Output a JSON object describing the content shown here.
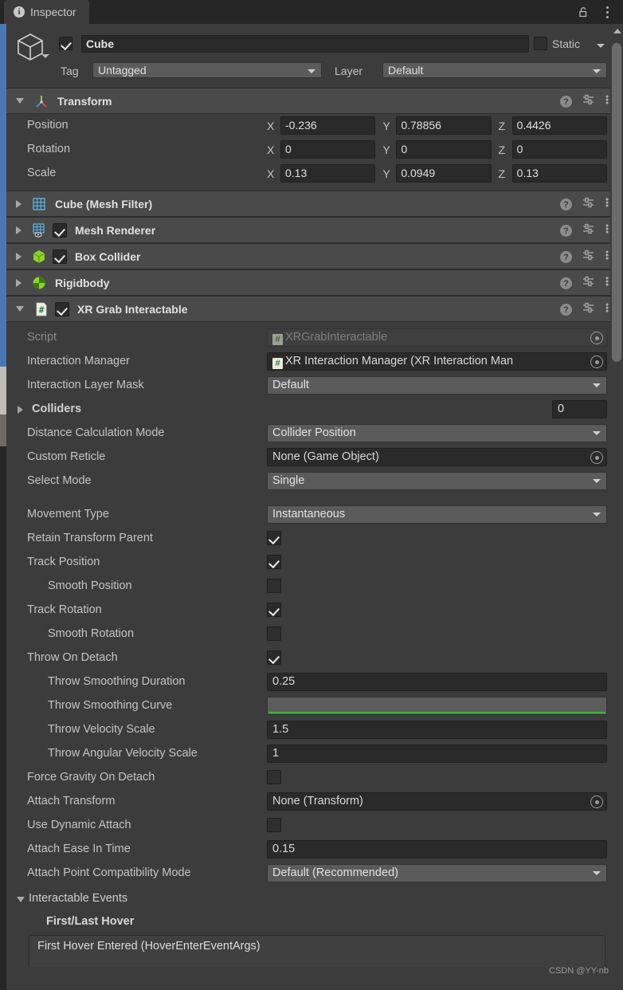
{
  "window": {
    "tab_label": "Inspector",
    "info_icon": "info-icon",
    "lock_icon": "lock-icon",
    "menu_icon": "kebab-menu-icon"
  },
  "object_header": {
    "icon": "cube-icon",
    "enabled": true,
    "name": "Cube",
    "static_label": "Static",
    "static_checked": false,
    "tag_label": "Tag",
    "tag_value": "Untagged",
    "layer_label": "Layer",
    "layer_value": "Default"
  },
  "transform": {
    "title": "Transform",
    "icon": "transform-axis-icon",
    "expanded": true,
    "rows": [
      {
        "label": "Position",
        "x": "-0.236",
        "y": "0.78856",
        "z": "0.4426"
      },
      {
        "label": "Rotation",
        "x": "0",
        "y": "0",
        "z": "0"
      },
      {
        "label": "Scale",
        "x": "0.13",
        "y": "0.0949",
        "z": "0.13"
      }
    ],
    "axes": [
      "X",
      "Y",
      "Z"
    ]
  },
  "components": [
    {
      "title": "Cube (Mesh Filter)",
      "icon": "mesh-filter-icon",
      "expanded": false,
      "has_checkbox": false,
      "checked": false
    },
    {
      "title": "Mesh Renderer",
      "icon": "mesh-renderer-icon",
      "expanded": false,
      "has_checkbox": true,
      "checked": true
    },
    {
      "title": "Box Collider",
      "icon": "box-collider-icon",
      "expanded": false,
      "has_checkbox": true,
      "checked": true
    },
    {
      "title": "Rigidbody",
      "icon": "rigidbody-icon",
      "expanded": false,
      "has_checkbox": false,
      "checked": false
    },
    {
      "title": "XR Grab Interactable",
      "icon": "script-icon",
      "expanded": true,
      "has_checkbox": true,
      "checked": true
    }
  ],
  "header_icons": {
    "help": "?",
    "help_name": "help-icon",
    "preset_name": "preset-settings-icon",
    "menu_name": "kebab-menu-icon"
  },
  "xr_grab_interactable": {
    "properties": [
      {
        "label": "Script",
        "type": "object-disabled",
        "value": "XRGrabInteractable",
        "icon": "script-icon"
      },
      {
        "label": "Interaction Manager",
        "type": "object",
        "value": "XR Interaction Manager (XR Interaction Man",
        "icon": "script-icon"
      },
      {
        "label": "Interaction Layer Mask",
        "type": "dropdown",
        "value": "Default"
      },
      {
        "label": "Colliders",
        "type": "foldout-count",
        "value": "0"
      },
      {
        "label": "Distance Calculation Mode",
        "type": "dropdown",
        "value": "Collider Position"
      },
      {
        "label": "Custom Reticle",
        "type": "object",
        "value": "None (Game Object)"
      },
      {
        "label": "Select Mode",
        "type": "dropdown",
        "value": "Single"
      },
      {
        "label": "",
        "type": "spacer"
      },
      {
        "label": "Movement Type",
        "type": "dropdown",
        "value": "Instantaneous"
      },
      {
        "label": "Retain Transform Parent",
        "type": "checkbox",
        "checked": true
      },
      {
        "label": "Track Position",
        "type": "checkbox",
        "checked": true
      },
      {
        "label": "Smooth Position",
        "type": "checkbox",
        "checked": false,
        "indent": true
      },
      {
        "label": "Track Rotation",
        "type": "checkbox",
        "checked": true
      },
      {
        "label": "Smooth Rotation",
        "type": "checkbox",
        "checked": false,
        "indent": true
      },
      {
        "label": "Throw On Detach",
        "type": "checkbox",
        "checked": true
      },
      {
        "label": "Throw Smoothing Duration",
        "type": "text",
        "value": "0.25",
        "indent": true
      },
      {
        "label": "Throw Smoothing Curve",
        "type": "curve",
        "indent": true
      },
      {
        "label": "Throw Velocity Scale",
        "type": "text",
        "value": "1.5",
        "indent": true
      },
      {
        "label": "Throw Angular Velocity Scale",
        "type": "text",
        "value": "1",
        "indent": true
      },
      {
        "label": "Force Gravity On Detach",
        "type": "checkbox",
        "checked": false
      },
      {
        "label": "Attach Transform",
        "type": "object",
        "value": "None (Transform)"
      },
      {
        "label": "Use Dynamic Attach",
        "type": "checkbox",
        "checked": false
      },
      {
        "label": "Attach Ease In Time",
        "type": "text",
        "value": "0.15"
      },
      {
        "label": "Attach Point Compatibility Mode",
        "type": "dropdown",
        "value": "Default (Recommended)"
      }
    ]
  },
  "events": {
    "section_title": "Interactable Events",
    "group_title": "First/Last Hover",
    "first_event": "First Hover Entered (HoverEnterEventArgs)"
  },
  "watermark": "CSDN @YY-nb",
  "colors": {
    "panel": "#3c3c3c",
    "header": "#4a4a4a",
    "field_dark": "#2a2a2a",
    "dropdown": "#5b5b5b",
    "text": "#c4c4c4",
    "accent_blue": "#4a78b4",
    "curve_green": "#27c527"
  }
}
